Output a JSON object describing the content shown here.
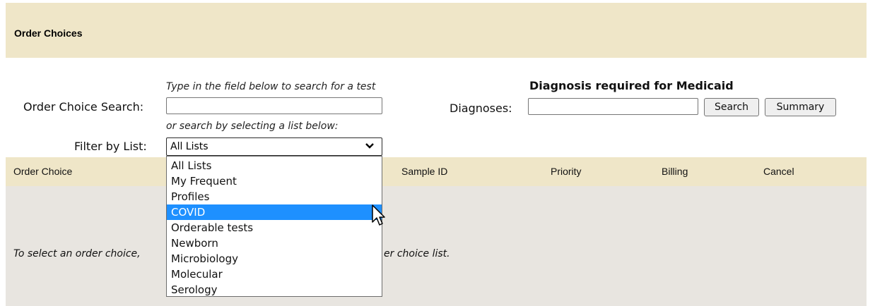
{
  "header": {
    "title": "Order Choices"
  },
  "search": {
    "hint": "Type in the field below to search for a test",
    "label": "Order Choice Search:",
    "value": "",
    "alt_hint": "or search by selecting a list below:"
  },
  "filter": {
    "label": "Filter by List:",
    "selected": "All Lists",
    "options": [
      "All Lists",
      "My Frequent",
      "Profiles",
      "COVID",
      "Orderable tests",
      "Newborn",
      "Microbiology",
      "Molecular",
      "Serology"
    ],
    "highlighted_index": 3
  },
  "diagnosis": {
    "heading": "Diagnosis required for Medicaid",
    "label": "Diagnoses:",
    "value": "",
    "search_button": "Search",
    "summary_button": "Summary"
  },
  "table": {
    "columns": [
      "Order Choice",
      "Sample ID",
      "Priority",
      "Billing",
      "Cancel"
    ],
    "empty_message_left": "To select an order choice,",
    "empty_message_right": "er choice list."
  },
  "colors": {
    "header_bg": "#efe6c8",
    "body_bg": "#e8e5e0",
    "highlight": "#1e90ff"
  },
  "icons": {
    "select_chevron": "chevron-down-icon",
    "cursor": "mouse-pointer-icon"
  }
}
